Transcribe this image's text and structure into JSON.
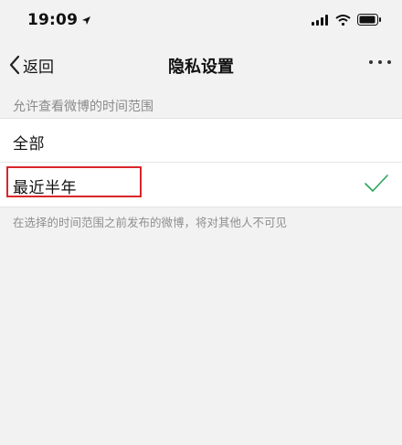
{
  "status_bar": {
    "time": "19:09",
    "icons": [
      "location-arrow-icon",
      "signal-icon",
      "wifi-icon",
      "battery-icon"
    ]
  },
  "nav": {
    "back_label": "返回",
    "title": "隐私设置",
    "more_icon": "more-dots-icon"
  },
  "section": {
    "header": "允许查看微博的时间范围",
    "options": [
      {
        "label": "全部",
        "selected": false
      },
      {
        "label": "最近半年",
        "selected": true
      }
    ]
  },
  "footer_note": "在选择的时间范围之前发布的微博，将对其他人不可见",
  "colors": {
    "background": "#f2f2f2",
    "check": "#2aa35a",
    "highlight": "#d9262a"
  }
}
